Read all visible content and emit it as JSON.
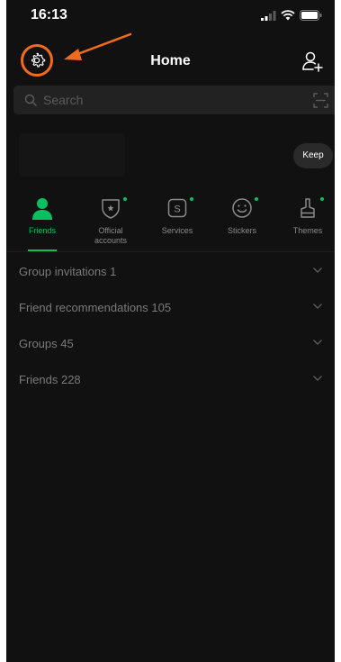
{
  "status_bar": {
    "time": "16:13"
  },
  "header": {
    "title": "Home"
  },
  "search": {
    "placeholder": "Search"
  },
  "banner": {
    "keep_label": "Keep"
  },
  "tabs": [
    {
      "label": "Friends",
      "icon": "person-icon",
      "active": true,
      "badge": false
    },
    {
      "label": "Official accounts",
      "icon": "shield-icon",
      "active": false,
      "badge": true
    },
    {
      "label": "Services",
      "icon": "services-icon",
      "active": false,
      "badge": true
    },
    {
      "label": "Stickers",
      "icon": "smiley-icon",
      "active": false,
      "badge": true
    },
    {
      "label": "Themes",
      "icon": "brush-icon",
      "active": false,
      "badge": true
    }
  ],
  "sections": [
    {
      "label": "Group invitations 1"
    },
    {
      "label": "Friend recommendations 105"
    },
    {
      "label": "Groups 45"
    },
    {
      "label": "Friends 228"
    }
  ],
  "colors": {
    "background": "#111111",
    "accent": "#07c160",
    "highlight": "#f26b1d"
  }
}
